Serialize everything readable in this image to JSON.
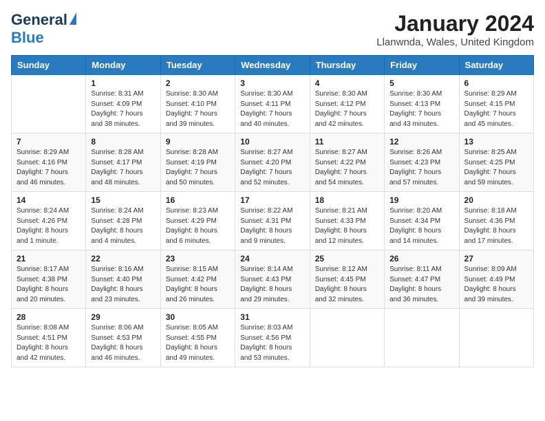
{
  "header": {
    "logo_general": "General",
    "logo_blue": "Blue",
    "title": "January 2024",
    "subtitle": "Llanwnda, Wales, United Kingdom"
  },
  "days_of_week": [
    "Sunday",
    "Monday",
    "Tuesday",
    "Wednesday",
    "Thursday",
    "Friday",
    "Saturday"
  ],
  "weeks": [
    [
      {
        "day": "",
        "sunrise": "",
        "sunset": "",
        "daylight": ""
      },
      {
        "day": "1",
        "sunrise": "Sunrise: 8:31 AM",
        "sunset": "Sunset: 4:09 PM",
        "daylight": "Daylight: 7 hours and 38 minutes."
      },
      {
        "day": "2",
        "sunrise": "Sunrise: 8:30 AM",
        "sunset": "Sunset: 4:10 PM",
        "daylight": "Daylight: 7 hours and 39 minutes."
      },
      {
        "day": "3",
        "sunrise": "Sunrise: 8:30 AM",
        "sunset": "Sunset: 4:11 PM",
        "daylight": "Daylight: 7 hours and 40 minutes."
      },
      {
        "day": "4",
        "sunrise": "Sunrise: 8:30 AM",
        "sunset": "Sunset: 4:12 PM",
        "daylight": "Daylight: 7 hours and 42 minutes."
      },
      {
        "day": "5",
        "sunrise": "Sunrise: 8:30 AM",
        "sunset": "Sunset: 4:13 PM",
        "daylight": "Daylight: 7 hours and 43 minutes."
      },
      {
        "day": "6",
        "sunrise": "Sunrise: 8:29 AM",
        "sunset": "Sunset: 4:15 PM",
        "daylight": "Daylight: 7 hours and 45 minutes."
      }
    ],
    [
      {
        "day": "7",
        "sunrise": "Sunrise: 8:29 AM",
        "sunset": "Sunset: 4:16 PM",
        "daylight": "Daylight: 7 hours and 46 minutes."
      },
      {
        "day": "8",
        "sunrise": "Sunrise: 8:28 AM",
        "sunset": "Sunset: 4:17 PM",
        "daylight": "Daylight: 7 hours and 48 minutes."
      },
      {
        "day": "9",
        "sunrise": "Sunrise: 8:28 AM",
        "sunset": "Sunset: 4:19 PM",
        "daylight": "Daylight: 7 hours and 50 minutes."
      },
      {
        "day": "10",
        "sunrise": "Sunrise: 8:27 AM",
        "sunset": "Sunset: 4:20 PM",
        "daylight": "Daylight: 7 hours and 52 minutes."
      },
      {
        "day": "11",
        "sunrise": "Sunrise: 8:27 AM",
        "sunset": "Sunset: 4:22 PM",
        "daylight": "Daylight: 7 hours and 54 minutes."
      },
      {
        "day": "12",
        "sunrise": "Sunrise: 8:26 AM",
        "sunset": "Sunset: 4:23 PM",
        "daylight": "Daylight: 7 hours and 57 minutes."
      },
      {
        "day": "13",
        "sunrise": "Sunrise: 8:25 AM",
        "sunset": "Sunset: 4:25 PM",
        "daylight": "Daylight: 7 hours and 59 minutes."
      }
    ],
    [
      {
        "day": "14",
        "sunrise": "Sunrise: 8:24 AM",
        "sunset": "Sunset: 4:26 PM",
        "daylight": "Daylight: 8 hours and 1 minute."
      },
      {
        "day": "15",
        "sunrise": "Sunrise: 8:24 AM",
        "sunset": "Sunset: 4:28 PM",
        "daylight": "Daylight: 8 hours and 4 minutes."
      },
      {
        "day": "16",
        "sunrise": "Sunrise: 8:23 AM",
        "sunset": "Sunset: 4:29 PM",
        "daylight": "Daylight: 8 hours and 6 minutes."
      },
      {
        "day": "17",
        "sunrise": "Sunrise: 8:22 AM",
        "sunset": "Sunset: 4:31 PM",
        "daylight": "Daylight: 8 hours and 9 minutes."
      },
      {
        "day": "18",
        "sunrise": "Sunrise: 8:21 AM",
        "sunset": "Sunset: 4:33 PM",
        "daylight": "Daylight: 8 hours and 12 minutes."
      },
      {
        "day": "19",
        "sunrise": "Sunrise: 8:20 AM",
        "sunset": "Sunset: 4:34 PM",
        "daylight": "Daylight: 8 hours and 14 minutes."
      },
      {
        "day": "20",
        "sunrise": "Sunrise: 8:18 AM",
        "sunset": "Sunset: 4:36 PM",
        "daylight": "Daylight: 8 hours and 17 minutes."
      }
    ],
    [
      {
        "day": "21",
        "sunrise": "Sunrise: 8:17 AM",
        "sunset": "Sunset: 4:38 PM",
        "daylight": "Daylight: 8 hours and 20 minutes."
      },
      {
        "day": "22",
        "sunrise": "Sunrise: 8:16 AM",
        "sunset": "Sunset: 4:40 PM",
        "daylight": "Daylight: 8 hours and 23 minutes."
      },
      {
        "day": "23",
        "sunrise": "Sunrise: 8:15 AM",
        "sunset": "Sunset: 4:42 PM",
        "daylight": "Daylight: 8 hours and 26 minutes."
      },
      {
        "day": "24",
        "sunrise": "Sunrise: 8:14 AM",
        "sunset": "Sunset: 4:43 PM",
        "daylight": "Daylight: 8 hours and 29 minutes."
      },
      {
        "day": "25",
        "sunrise": "Sunrise: 8:12 AM",
        "sunset": "Sunset: 4:45 PM",
        "daylight": "Daylight: 8 hours and 32 minutes."
      },
      {
        "day": "26",
        "sunrise": "Sunrise: 8:11 AM",
        "sunset": "Sunset: 4:47 PM",
        "daylight": "Daylight: 8 hours and 36 minutes."
      },
      {
        "day": "27",
        "sunrise": "Sunrise: 8:09 AM",
        "sunset": "Sunset: 4:49 PM",
        "daylight": "Daylight: 8 hours and 39 minutes."
      }
    ],
    [
      {
        "day": "28",
        "sunrise": "Sunrise: 8:08 AM",
        "sunset": "Sunset: 4:51 PM",
        "daylight": "Daylight: 8 hours and 42 minutes."
      },
      {
        "day": "29",
        "sunrise": "Sunrise: 8:06 AM",
        "sunset": "Sunset: 4:53 PM",
        "daylight": "Daylight: 8 hours and 46 minutes."
      },
      {
        "day": "30",
        "sunrise": "Sunrise: 8:05 AM",
        "sunset": "Sunset: 4:55 PM",
        "daylight": "Daylight: 8 hours and 49 minutes."
      },
      {
        "day": "31",
        "sunrise": "Sunrise: 8:03 AM",
        "sunset": "Sunset: 4:56 PM",
        "daylight": "Daylight: 8 hours and 53 minutes."
      },
      {
        "day": "",
        "sunrise": "",
        "sunset": "",
        "daylight": ""
      },
      {
        "day": "",
        "sunrise": "",
        "sunset": "",
        "daylight": ""
      },
      {
        "day": "",
        "sunrise": "",
        "sunset": "",
        "daylight": ""
      }
    ]
  ]
}
